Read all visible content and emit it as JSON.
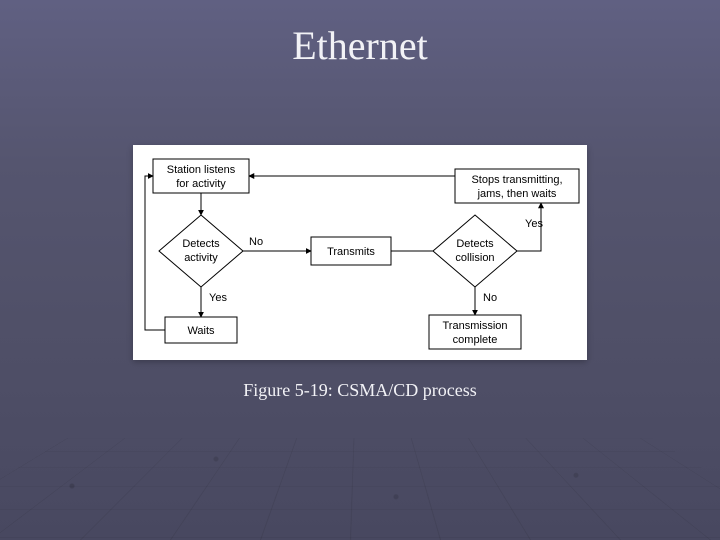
{
  "title": "Ethernet",
  "caption": "Figure 5-19: CSMA/CD process",
  "flow": {
    "listen": "Station listens\nfor activity",
    "detects_activity": "Detects\nactivity",
    "transmits": "Transmits",
    "detects_collision": "Detects\ncollision",
    "stops": "Stops transmitting,\njams, then waits",
    "waits": "Waits",
    "complete": "Transmission\ncomplete",
    "no": "No",
    "yes": "Yes"
  }
}
